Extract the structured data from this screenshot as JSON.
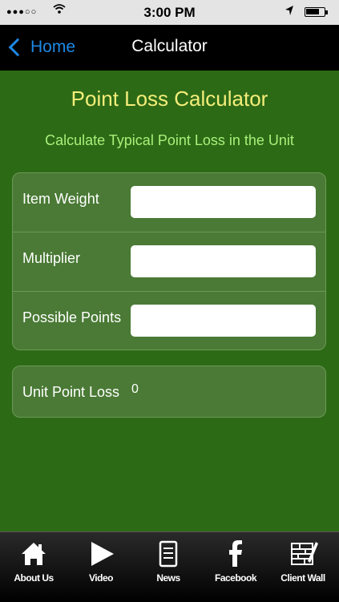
{
  "status_bar": {
    "signal": "●●●○○",
    "time": "3:00 PM"
  },
  "nav": {
    "back_label": "Home",
    "title": "Calculator"
  },
  "page": {
    "title": "Point Loss Calculator",
    "subtitle": "Calculate Typical Point Loss in the Unit"
  },
  "form": {
    "fields": [
      {
        "label": "Item Weight",
        "value": ""
      },
      {
        "label": "Multiplier",
        "value": ""
      },
      {
        "label": "Possible Points",
        "value": ""
      }
    ]
  },
  "result": {
    "label": "Unit Point Loss",
    "value": "0"
  },
  "tabs": [
    {
      "label": "About Us",
      "icon": "home-icon"
    },
    {
      "label": "Video",
      "icon": "play-icon"
    },
    {
      "label": "News",
      "icon": "document-icon"
    },
    {
      "label": "Facebook",
      "icon": "facebook-icon"
    },
    {
      "label": "Client Wall",
      "icon": "wall-icon"
    }
  ],
  "colors": {
    "background": "#2d6a16",
    "title": "#f4ee7a",
    "subtitle": "#a8f07a",
    "link": "#1e88e5"
  }
}
